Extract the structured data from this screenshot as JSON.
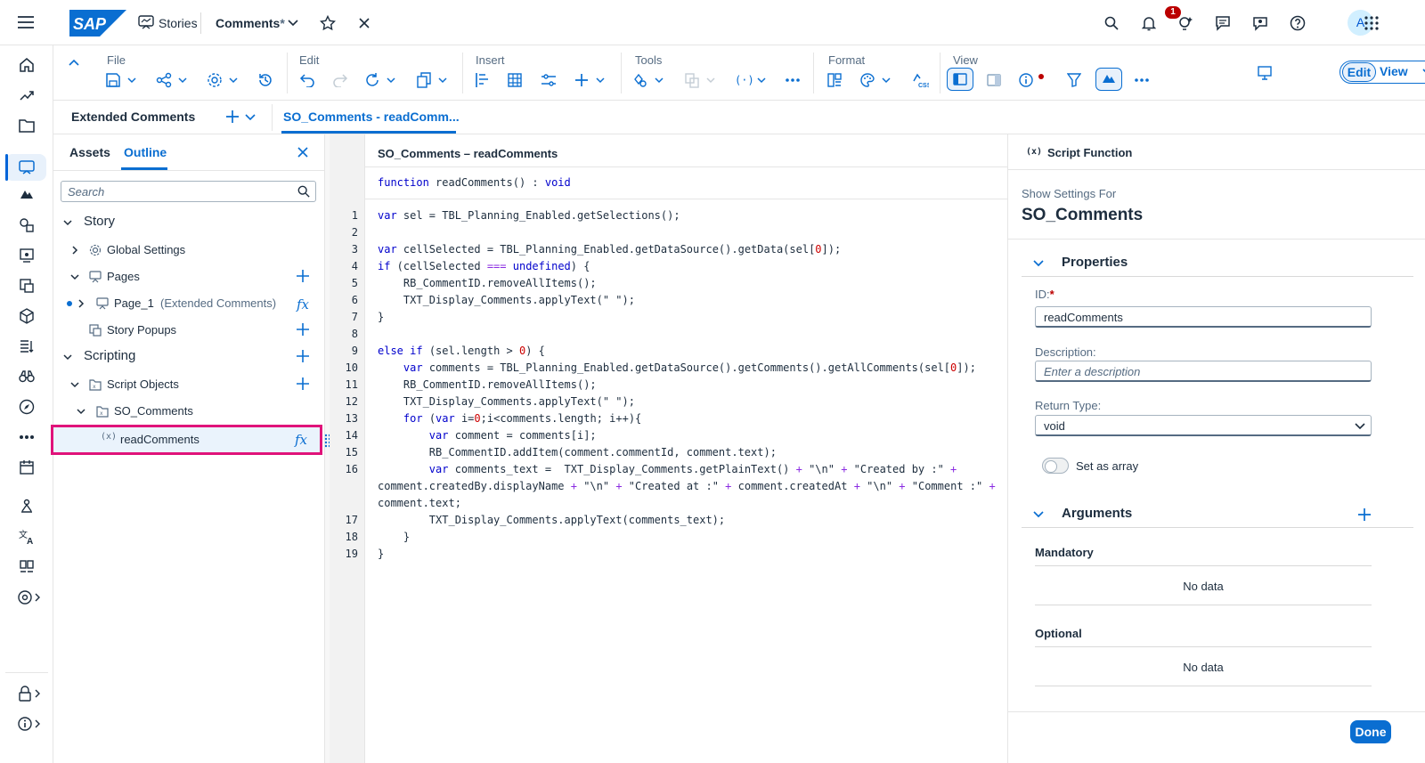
{
  "shell": {
    "app_name": "Stories",
    "doc_title": "Comments",
    "doc_modified_mark": "*",
    "notification_count": "1",
    "avatar_initial": "A"
  },
  "toolbar": {
    "groups": {
      "file": "File",
      "edit": "Edit",
      "insert": "Insert",
      "tools": "Tools",
      "format": "Format",
      "view": "View"
    },
    "mode": {
      "edit": "Edit",
      "view": "View"
    }
  },
  "tabs": {
    "page_tab": "Extended Comments",
    "script_tab": "SO_Comments - readComm..."
  },
  "outline": {
    "tabs": {
      "assets": "Assets",
      "outline": "Outline"
    },
    "search_placeholder": "Search",
    "tree": {
      "story": "Story",
      "global_settings": "Global Settings",
      "pages": "Pages",
      "page_1": "Page_1",
      "page_1_sub": "(Extended Comments)",
      "story_popups": "Story Popups",
      "scripting": "Scripting",
      "script_objects": "Script Objects",
      "so_comments": "SO_Comments",
      "read_comments": "readComments"
    }
  },
  "editor": {
    "title": "SO_Comments – readComments",
    "signature_kw": "function",
    "signature_name": " readComments() : ",
    "signature_type": "void",
    "lines": [
      {
        "n": "1",
        "t": "var sel = TBL_Planning_Enabled.getSelections();"
      },
      {
        "n": "2",
        "t": ""
      },
      {
        "n": "3",
        "t": "var cellSelected = TBL_Planning_Enabled.getDataSource().getData(sel[0]);"
      },
      {
        "n": "4",
        "t": "if (cellSelected === undefined) {"
      },
      {
        "n": "5",
        "t": "    RB_CommentID.removeAllItems();"
      },
      {
        "n": "6",
        "t": "    TXT_Display_Comments.applyText(\" \");"
      },
      {
        "n": "7",
        "t": "}"
      },
      {
        "n": "8",
        "t": ""
      },
      {
        "n": "9",
        "t": "else if (sel.length > 0) {"
      },
      {
        "n": "10",
        "t": "    var comments = TBL_Planning_Enabled.getDataSource().getComments().getAllComments(sel[0]);"
      },
      {
        "n": "11",
        "t": "    RB_CommentID.removeAllItems();"
      },
      {
        "n": "12",
        "t": "    TXT_Display_Comments.applyText(\" \");"
      },
      {
        "n": "13",
        "t": "    for (var i=0;i<comments.length; i++){"
      },
      {
        "n": "14",
        "t": "        var comment = comments[i];"
      },
      {
        "n": "15",
        "t": "        RB_CommentID.addItem(comment.commentId, comment.text);"
      },
      {
        "n": "16",
        "t": "        var comments_text =  TXT_Display_Comments.getPlainText() + \"\\n\" + \"Created by :\" +"
      },
      {
        "n": "",
        "t": "comment.createdBy.displayName + \"\\n\" + \"Created at :\" + comment.createdAt + \"\\n\" + \"Comment :\" +"
      },
      {
        "n": "",
        "t": "comment.text;"
      },
      {
        "n": "17",
        "t": "        TXT_Display_Comments.applyText(comments_text);"
      },
      {
        "n": "18",
        "t": "    }"
      },
      {
        "n": "19",
        "t": "}"
      }
    ]
  },
  "props": {
    "header": "Script Function",
    "show_settings_for": "Show Settings For",
    "object_name": "SO_Comments",
    "properties_title": "Properties",
    "id_label": "ID:",
    "id_required": "*",
    "id_value": "readComments",
    "description_label": "Description:",
    "description_placeholder": "Enter a description",
    "return_type_label": "Return Type:",
    "return_type_value": "void",
    "set_as_array": "Set as array",
    "arguments_title": "Arguments",
    "mandatory": "Mandatory",
    "mandatory_empty": "No data",
    "optional": "Optional",
    "optional_empty": "No data",
    "done": "Done"
  },
  "colors": {
    "accent": "#0a6ed1",
    "highlight": "#e0137a",
    "badge": "#bb0000"
  }
}
